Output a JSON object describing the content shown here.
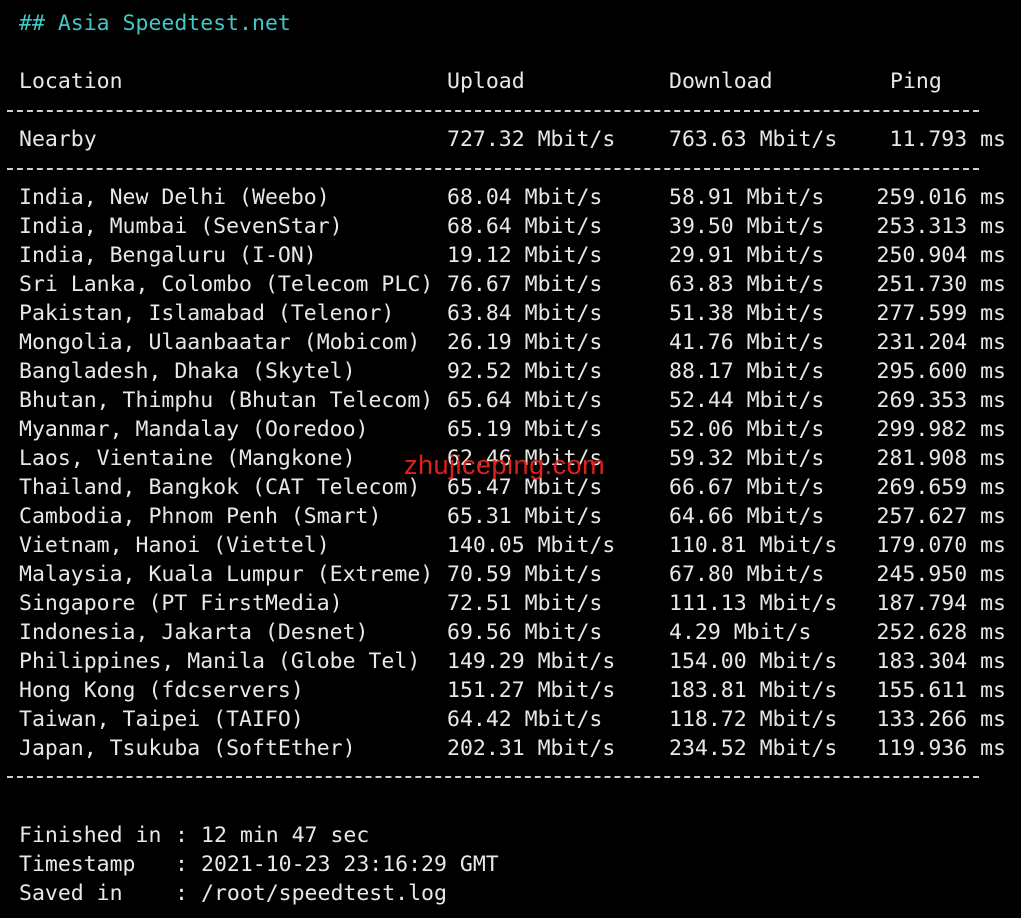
{
  "title": "## Asia Speedtest.net",
  "header": {
    "location": "Location",
    "upload": "Upload",
    "download": "Download",
    "ping": "Ping"
  },
  "nearby": {
    "location": "Nearby",
    "upload": "727.32 Mbit/s",
    "download": "763.63 Mbit/s",
    "ping": "11.793 ms"
  },
  "rows": [
    {
      "location": "India, New Delhi (Weebo)",
      "upload": "68.04 Mbit/s",
      "download": "58.91 Mbit/s",
      "ping": "259.016 ms"
    },
    {
      "location": "India, Mumbai (SevenStar)",
      "upload": "68.64 Mbit/s",
      "download": "39.50 Mbit/s",
      "ping": "253.313 ms"
    },
    {
      "location": "India, Bengaluru (I-ON)",
      "upload": "19.12 Mbit/s",
      "download": "29.91 Mbit/s",
      "ping": "250.904 ms"
    },
    {
      "location": "Sri Lanka, Colombo (Telecom PLC)",
      "upload": "76.67 Mbit/s",
      "download": "63.83 Mbit/s",
      "ping": "251.730 ms"
    },
    {
      "location": "Pakistan, Islamabad (Telenor)",
      "upload": "63.84 Mbit/s",
      "download": "51.38 Mbit/s",
      "ping": "277.599 ms"
    },
    {
      "location": "Mongolia, Ulaanbaatar (Mobicom)",
      "upload": "26.19 Mbit/s",
      "download": "41.76 Mbit/s",
      "ping": "231.204 ms"
    },
    {
      "location": "Bangladesh, Dhaka (Skytel)",
      "upload": "92.52 Mbit/s",
      "download": "88.17 Mbit/s",
      "ping": "295.600 ms"
    },
    {
      "location": "Bhutan, Thimphu (Bhutan Telecom)",
      "upload": "65.64 Mbit/s",
      "download": "52.44 Mbit/s",
      "ping": "269.353 ms"
    },
    {
      "location": "Myanmar, Mandalay (Ooredoo)",
      "upload": "65.19 Mbit/s",
      "download": "52.06 Mbit/s",
      "ping": "299.982 ms"
    },
    {
      "location": "Laos, Vientaine (Mangkone)",
      "upload": "62.46 Mbit/s",
      "download": "59.32 Mbit/s",
      "ping": "281.908 ms"
    },
    {
      "location": "Thailand, Bangkok (CAT Telecom)",
      "upload": "65.47 Mbit/s",
      "download": "66.67 Mbit/s",
      "ping": "269.659 ms"
    },
    {
      "location": "Cambodia, Phnom Penh (Smart)",
      "upload": "65.31 Mbit/s",
      "download": "64.66 Mbit/s",
      "ping": "257.627 ms"
    },
    {
      "location": "Vietnam, Hanoi (Viettel)",
      "upload": "140.05 Mbit/s",
      "download": "110.81 Mbit/s",
      "ping": "179.070 ms"
    },
    {
      "location": "Malaysia, Kuala Lumpur (Extreme)",
      "upload": "70.59 Mbit/s",
      "download": "67.80 Mbit/s",
      "ping": "245.950 ms"
    },
    {
      "location": "Singapore (PT FirstMedia)",
      "upload": "72.51 Mbit/s",
      "download": "111.13 Mbit/s",
      "ping": "187.794 ms"
    },
    {
      "location": "Indonesia, Jakarta (Desnet)",
      "upload": "69.56 Mbit/s",
      "download": "4.29 Mbit/s",
      "ping": "252.628 ms"
    },
    {
      "location": "Philippines, Manila (Globe Tel)",
      "upload": "149.29 Mbit/s",
      "download": "154.00 Mbit/s",
      "ping": "183.304 ms"
    },
    {
      "location": "Hong Kong (fdcservers)",
      "upload": "151.27 Mbit/s",
      "download": "183.81 Mbit/s",
      "ping": "155.611 ms"
    },
    {
      "location": "Taiwan, Taipei (TAIFO)",
      "upload": "64.42 Mbit/s",
      "download": "118.72 Mbit/s",
      "ping": "133.266 ms"
    },
    {
      "location": "Japan, Tsukuba (SoftEther)",
      "upload": "202.31 Mbit/s",
      "download": "234.52 Mbit/s",
      "ping": "119.936 ms"
    }
  ],
  "footer": {
    "finished_label": "Finished in",
    "finished_value": "12 min 47 sec",
    "timestamp_label": "Timestamp",
    "timestamp_value": "2021-10-23 23:16:29 GMT",
    "saved_label": "Saved in",
    "saved_value": "/root/speedtest.log",
    "colon": ":"
  },
  "watermark": "zhujiceping.com",
  "colors": {
    "background": "#000000",
    "text": "#e8e8e8",
    "title": "#3ec9c9",
    "watermark": "#e0201a"
  }
}
